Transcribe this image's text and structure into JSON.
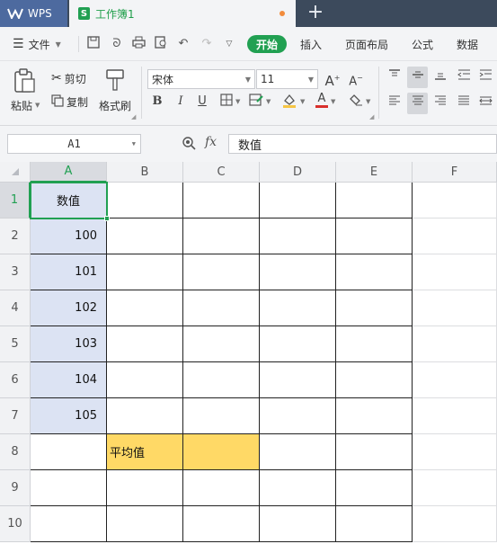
{
  "app": {
    "logo_text": "WPS",
    "document_tab": "工作簿1",
    "new_tab_symbol": "+"
  },
  "menu": {
    "file_label": "文件",
    "tabs": [
      "开始",
      "插入",
      "页面布局",
      "公式",
      "数据"
    ]
  },
  "ribbon": {
    "paste_label": "粘贴",
    "cut_label": "剪切",
    "copy_label": "复制",
    "format_painter_label": "格式刷",
    "font_name": "宋体",
    "font_size": "11",
    "font_buttons": {
      "bold": "B",
      "italic": "I",
      "underline": "U"
    },
    "font_color_letter": "A"
  },
  "formula_bar": {
    "name_box": "A1",
    "fx_label": "fx",
    "value": "数值"
  },
  "grid": {
    "columns": [
      "A",
      "B",
      "C",
      "D",
      "E",
      "F"
    ],
    "rows": [
      "1",
      "2",
      "3",
      "4",
      "5",
      "6",
      "7",
      "8",
      "9",
      "10"
    ],
    "cells": {
      "A1": "数值",
      "A2": "100",
      "A3": "101",
      "A4": "102",
      "A5": "103",
      "A6": "104",
      "A7": "105",
      "B8": "平均值"
    },
    "colors": {
      "selected_fill": "#dce3f3",
      "highlight_fill": "#ffd966",
      "active_border": "#21a052"
    }
  }
}
